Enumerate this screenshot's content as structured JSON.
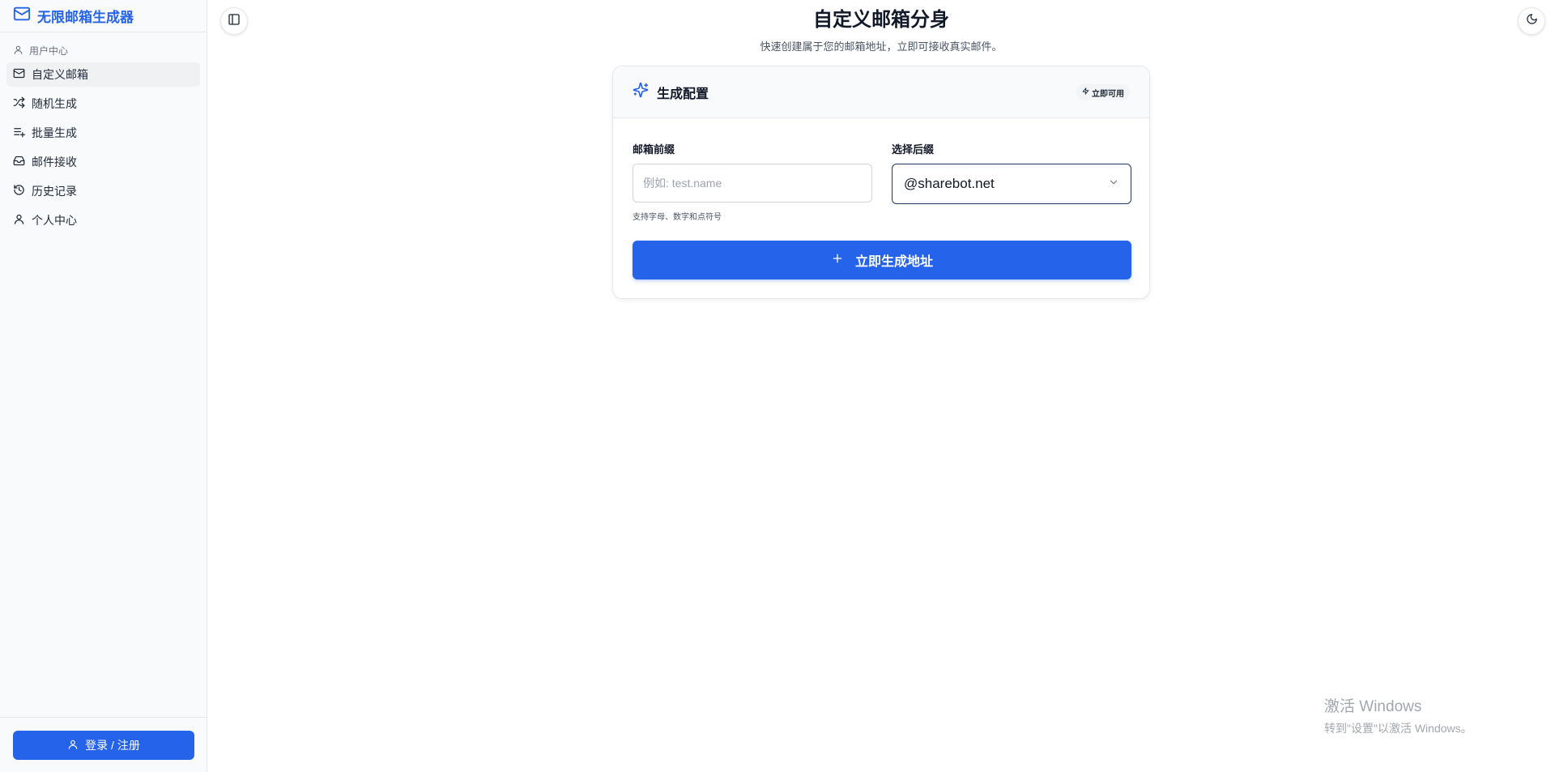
{
  "brand": {
    "title": "无限邮箱生成器",
    "accent": "#2563eb"
  },
  "sidebar": {
    "section_label": "用户中心",
    "items": [
      {
        "label": "自定义邮箱",
        "icon": "mail-icon",
        "active": true
      },
      {
        "label": "随机生成",
        "icon": "shuffle-icon"
      },
      {
        "label": "批量生成",
        "icon": "list-plus-icon"
      },
      {
        "label": "邮件接收",
        "icon": "inbox-icon"
      },
      {
        "label": "历史记录",
        "icon": "history-icon"
      },
      {
        "label": "个人中心",
        "icon": "user-icon"
      }
    ],
    "login_label": "登录 / 注册"
  },
  "header": {
    "title": "自定义邮箱分身",
    "subtitle": "快速创建属于您的邮箱地址，立即可接收真实邮件。"
  },
  "card": {
    "title": "生成配置",
    "badge": "立即可用",
    "prefix_label": "邮箱前缀",
    "prefix_placeholder": "例如: test.name",
    "prefix_value": "",
    "prefix_hint": "支持字母、数字和点符号",
    "suffix_label": "选择后缀",
    "suffix_value": "@sharebot.net",
    "generate_label": "立即生成地址"
  },
  "watermark": {
    "line1": "激活 Windows",
    "line2": "转到\"设置\"以激活 Windows。"
  }
}
